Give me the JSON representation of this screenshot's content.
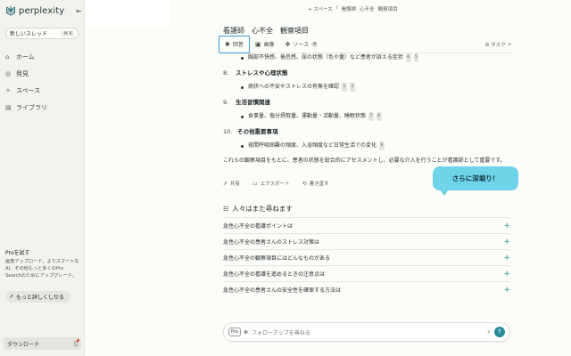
{
  "sidebar": {
    "brand": "perplexity",
    "new_thread": "新しいスレッド",
    "new_thread_kbd": "⌘ K",
    "nav": [
      {
        "label": "ホーム",
        "icon": "home-icon"
      },
      {
        "label": "発見",
        "icon": "globe-icon"
      },
      {
        "label": "スペース",
        "icon": "spaces-icon"
      },
      {
        "label": "ライブラリ",
        "icon": "library-icon"
      }
    ],
    "pro_title": "Proを試す",
    "pro_desc": "画像アップロード、よりスマートなAI、その他もっと多くのPro Searchのためにアップグレード。",
    "learn_more": "もっと詳しくしせる",
    "download": "ダウンロード"
  },
  "header": {
    "crumbs": [
      "+ スペース",
      "/",
      "看護師",
      "心不全",
      "観察項目"
    ],
    "thread_title": "看護師　心不全　観察項目"
  },
  "tabs": [
    {
      "label": "回答",
      "icon": "answer-icon"
    },
    {
      "label": "画像",
      "icon": "image-icon"
    },
    {
      "label": "ソース",
      "icon": "sources-icon",
      "badge": "8"
    }
  ],
  "tasks_label": "タスク",
  "content": {
    "bullet_top": "胸部不快感、倦怠感、尿の状態（色や量）など患者が訴える症状",
    "bullet_top_cites": [
      "6",
      "5"
    ],
    "items": [
      {
        "n": "8.",
        "title": "ストレスや心理状態",
        "bullet": "病状への不安やストレスの有無を確認",
        "cites": [
          "1",
          "3"
        ]
      },
      {
        "n": "9.",
        "title": "生活習慣関連",
        "bullet": "食事量、塩分摂取量、運動量・活動量、睡眠状態",
        "cites": [
          "7",
          "6"
        ]
      },
      {
        "n": "10.",
        "title": "その他重要事項",
        "bullet": "夜間呼吸困難の頻度、入浴頻度など日常生活での変化",
        "cites": [
          "6"
        ]
      }
    ],
    "paragraph": "これらの観察項目をもとに、患者の状態を総合的にアセスメントし、必要な介入を行うことが看護師として重要です。"
  },
  "actions": {
    "share": "共有",
    "export": "エクスポート",
    "rewrite": "書き直す"
  },
  "callout": "さらに深堀り！",
  "related": {
    "heading": "人々はまた尋ねます",
    "items": [
      "急性心不全の看護ポイントは",
      "急性心不全の患者さんのストレス対策は",
      "急性心不全の観察項目にはどんなものがある",
      "急性心不全の看護を進めるときの注意点は",
      "急性心不全の患者さんの安全性を確保する方法は"
    ]
  },
  "followup": {
    "chip": "Pro",
    "placeholder": "フォローアップを尋ねる"
  }
}
